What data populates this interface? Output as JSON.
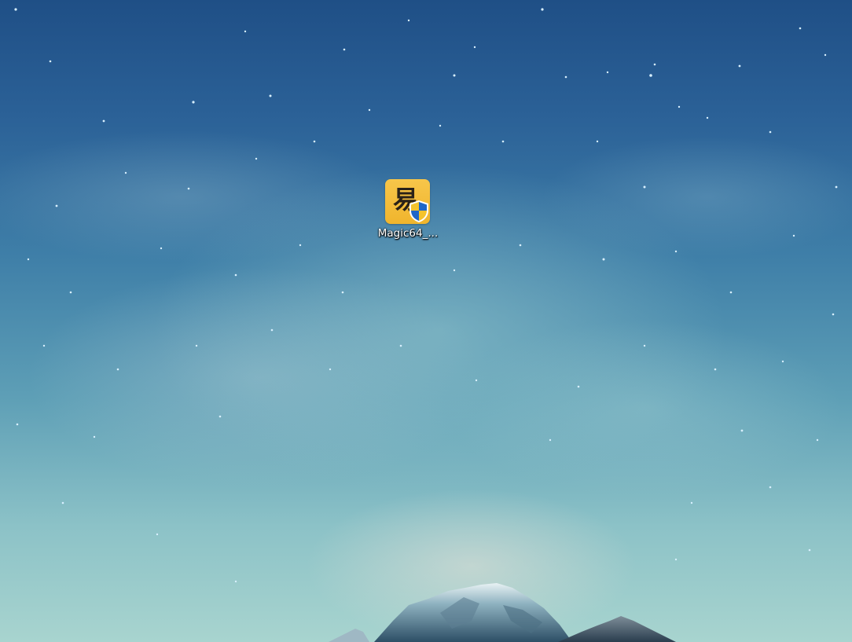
{
  "desktop": {
    "icons": [
      {
        "label": "Magic64_...",
        "glyph": "易",
        "icon": "magic-app-icon",
        "overlay_icon": "uac-shield-icon"
      }
    ]
  },
  "colors": {
    "sky_top": "#1f4f86",
    "sky_bottom": "#a8d4cf",
    "icon_bg": "#f0b52d",
    "shield_blue": "#1e66c8",
    "shield_yellow": "#f5c32c"
  }
}
